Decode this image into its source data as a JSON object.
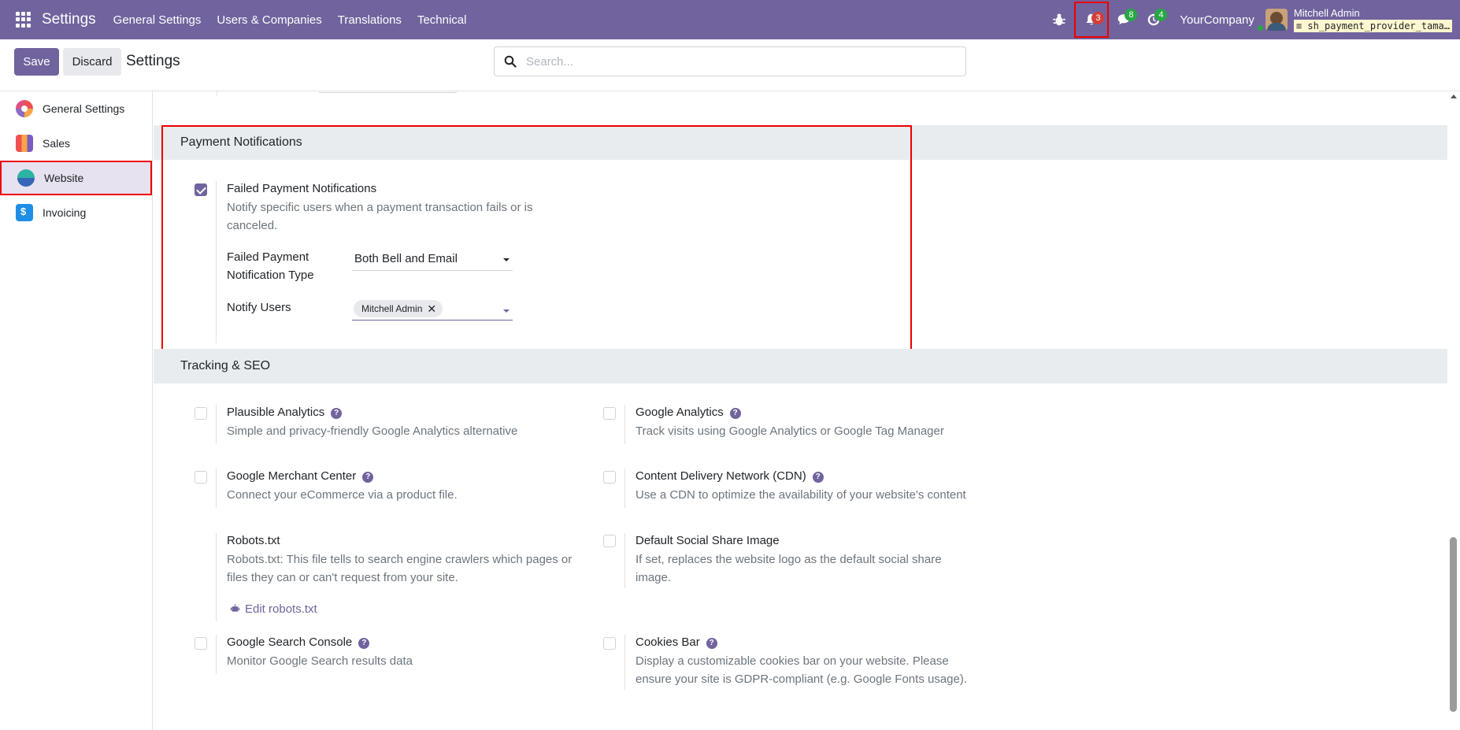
{
  "navbar": {
    "brand": "Settings",
    "menu": [
      "General Settings",
      "Users & Companies",
      "Translations",
      "Technical"
    ],
    "notifications_count": "3",
    "messages_count": "8",
    "activities_count": "4",
    "company": "YourCompany",
    "user_name": "Mitchell Admin",
    "database": "sh_payment_provider_tama…"
  },
  "control": {
    "save_label": "Save",
    "discard_label": "Discard",
    "title": "Settings",
    "search_placeholder": "Search..."
  },
  "sidebar": {
    "items": [
      {
        "label": "General Settings",
        "icon": "general-settings-icon"
      },
      {
        "label": "Sales",
        "icon": "sales-icon"
      },
      {
        "label": "Website",
        "icon": "website-icon",
        "active": true
      },
      {
        "label": "Invoicing",
        "icon": "invoicing-icon"
      }
    ]
  },
  "payment_notifications": {
    "heading": "Payment Notifications",
    "failed_title": "Failed Payment Notifications",
    "failed_checked": true,
    "failed_desc": "Notify specific users when a payment transaction fails or is canceled.",
    "type_label": "Failed Payment Notification Type",
    "type_value": "Both Bell and Email",
    "users_label": "Notify Users",
    "users_tag": "Mitchell Admin"
  },
  "tracking": {
    "heading": "Tracking & SEO",
    "settings": [
      {
        "title": "Plausible Analytics",
        "desc": "Simple and privacy-friendly Google Analytics alternative",
        "help": true,
        "checked": false
      },
      {
        "title": "Google Analytics",
        "desc": "Track visits using Google Analytics or Google Tag Manager",
        "help": true,
        "checked": false
      },
      {
        "title": "Google Merchant Center",
        "desc": "Connect your eCommerce via a product file.",
        "help": true,
        "checked": false
      },
      {
        "title": "Content Delivery Network (CDN)",
        "desc": "Use a CDN to optimize the availability of your website's content",
        "help": true,
        "checked": false
      },
      {
        "title": "Robots.txt",
        "desc": "Robots.txt: This file tells to search engine crawlers which pages or files they can or can't request from your site.",
        "link": "Edit robots.txt"
      },
      {
        "title": "Default Social Share Image",
        "desc": "If set, replaces the website logo as the default social share image.",
        "checked": false
      },
      {
        "title": "Google Search Console",
        "desc": "Monitor Google Search results data",
        "help": true,
        "checked": false
      },
      {
        "title": "Cookies Bar",
        "desc": "Display a customizable cookies bar on your website. Please ensure your site is GDPR-compliant (e.g. Google Fonts usage).",
        "help": true,
        "checked": false
      }
    ]
  },
  "help_glyph": "?",
  "colors": {
    "primary": "#71639e",
    "highlight": "#ee0000"
  }
}
